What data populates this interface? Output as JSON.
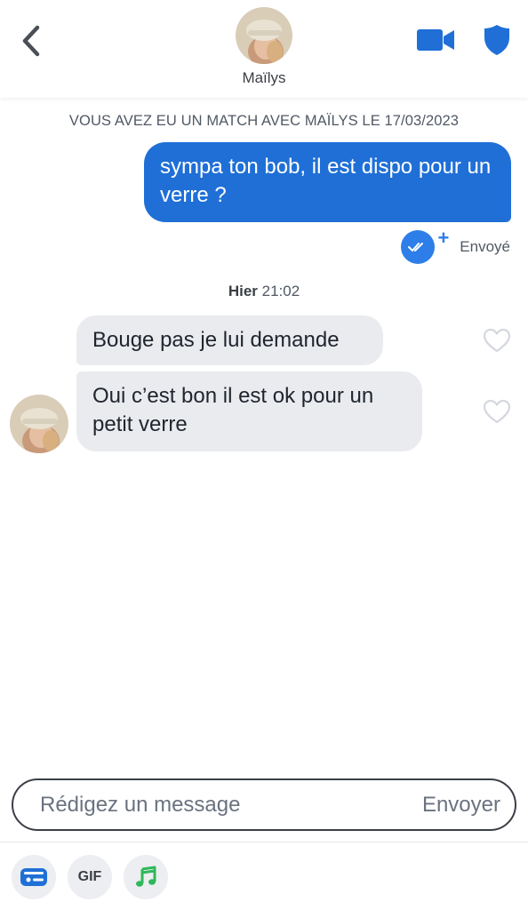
{
  "header": {
    "name": "Maïlys",
    "icons": {
      "back": "chevron-left-icon",
      "video": "video-camera-icon",
      "safety": "shield-icon"
    },
    "accent_color": "#1f6fd7"
  },
  "conversation": {
    "match_info": "VOUS AVEZ EU UN MATCH AVEC MAÏLYS LE 17/03/2023",
    "outgoing": {
      "text": "sympa ton bob, il est dispo pour un verre ?",
      "status": "Envoyé",
      "status_plus": "+"
    },
    "day_label": {
      "day": "Hier",
      "time": "21:02"
    },
    "incoming": [
      {
        "text": "Bouge pas je lui demande"
      },
      {
        "text": "Oui c’est bon il est ok pour un petit verre"
      }
    ]
  },
  "composer": {
    "placeholder": "Rédigez un message",
    "send_label": "Envoyer"
  },
  "toolbar": {
    "gif_label": "GIF",
    "icons": [
      "contact-card-icon",
      "gif-icon",
      "music-note-icon"
    ]
  }
}
